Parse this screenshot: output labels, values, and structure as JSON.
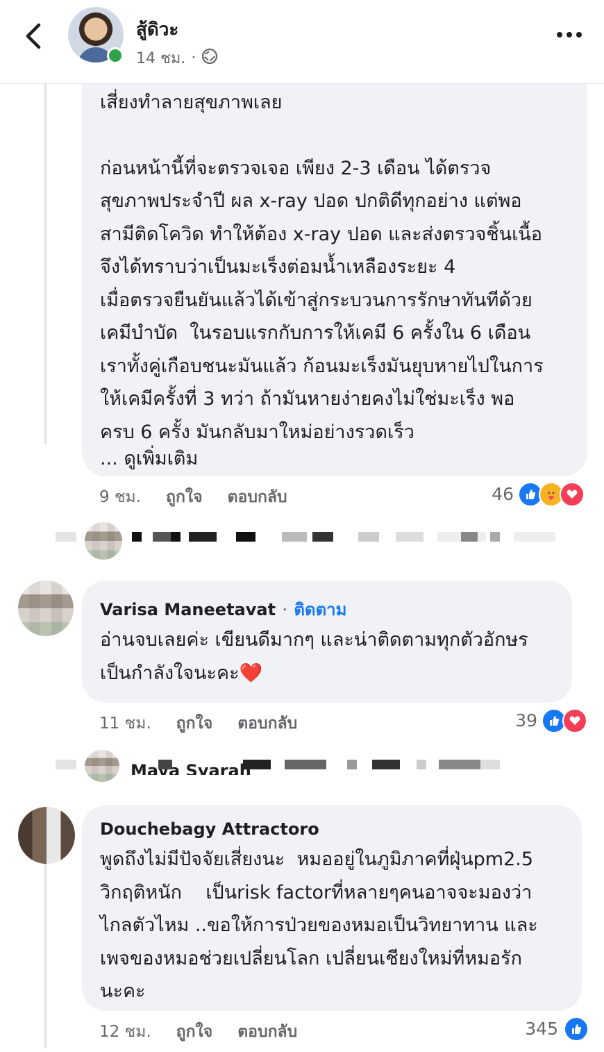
{
  "header": {
    "author": "สู้ดิวะ",
    "time": "14 ชม.",
    "separator": "·",
    "privacy_icon": "globe-icon",
    "back_icon": "chevron-left-icon",
    "more_icon": "more-horizontal-icon"
  },
  "comments": [
    {
      "lines": [
        "เสี่ยงทำลายสุขภาพเลย",
        "",
        "ก่อนหน้านี้ที่จะตรวจเจอ เพียง 2-3 เดือน ได้ตรวจ",
        "สุขภาพประจำปี ผล x-ray ปอด ปกติดีทุกอย่าง แต่พอ",
        "สามีติดโควิด ทำให้ต้อง x-ray ปอด และส่งตรวจชิ้นเนื้อ",
        "จึงได้ทราบว่าเป็นมะเร็งต่อมน้ำเหลืองระยะ 4",
        "เมื่อตรวจยืนยันแล้วได้เข้าสู่กระบวนการรักษาทันทีด้วย",
        "เคมีบำบัด  ในรอบแรกกับการให้เคมี 6 ครั้งใน 6 เดือน",
        "เราทั้งคู่เกือบชนะมันแล้ว ก้อนมะเร็งมันยุบหายไปในการ",
        "ให้เคมีครั้งที่ 3 ทว่า ถ้ามันหายง่ายคงไม่ใช่มะเร็ง พอ",
        "ครบ 6 ครั้ง มันกลับมาใหม่อย่างรวดเร็ว"
      ],
      "see_more": "... ดูเพิ่มเติม",
      "time": "9 ชม.",
      "like": "ถูกใจ",
      "reply": "ตอบกลับ",
      "reaction_count": "46",
      "reactions": [
        "like",
        "care",
        "love"
      ]
    },
    {
      "author": "Varisa Maneetavat",
      "dot": "·",
      "follow": "ติดตาม",
      "lines": [
        "อ่านจบเลยค่ะ เขียนดีมากๆ และน่าติดตามทุกตัวอักษร",
        "เป็นกำลังใจนะคะ❤️"
      ],
      "time": "11 ชม.",
      "like": "ถูกใจ",
      "reply": "ตอบกลับ",
      "reaction_count": "39",
      "reactions": [
        "like",
        "love"
      ]
    },
    {
      "author": "Douchebagy Attractoro",
      "lines": [
        "พูดถึงไม่มีปัจจัยเสี่ยงนะ  หมออยู่ในภูมิภาคที่ฝุ่นpm2.5",
        "วิกฤติหนัก    เป็นrisk factorที่หลายๆคนอาจจะมองว่า",
        "ไกลตัวไหม ..ขอให้การป่วยของหมอเป็นวิทยาทาน และ",
        "เพจของหมอช่วยเปลี่ยนโลก เปลี่ยนเชียงใหม่ที่หมอรัก",
        "นะคะ"
      ],
      "time": "12 ชม.",
      "like": "ถูกใจ",
      "reply": "ตอบกลับ",
      "reaction_count": "345",
      "reactions": [
        "like"
      ]
    }
  ],
  "reply_preview_2": {
    "name": "Maya Syarah"
  }
}
